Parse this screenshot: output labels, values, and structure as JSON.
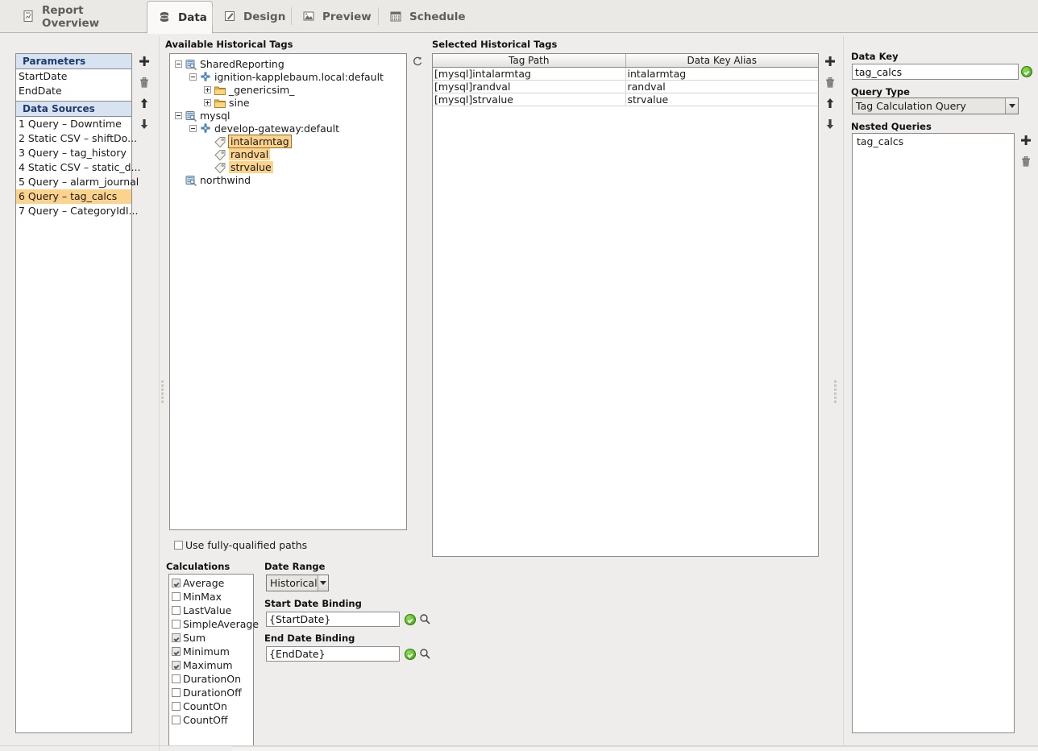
{
  "tabs": [
    {
      "label": "Report Overview",
      "icon": "report-icon",
      "active": false
    },
    {
      "label": "Data",
      "icon": "database-icon",
      "active": true
    },
    {
      "label": "Design",
      "icon": "pencil-icon",
      "active": false
    },
    {
      "label": "Preview",
      "icon": "image-icon",
      "active": false
    },
    {
      "label": "Schedule",
      "icon": "calendar-icon",
      "active": false
    }
  ],
  "left_panel": {
    "parameters_header": "Parameters",
    "parameters": [
      "StartDate",
      "EndDate"
    ],
    "data_sources_header": "Data Sources",
    "data_sources": [
      {
        "label": "1 Query – Downtime",
        "selected": false
      },
      {
        "label": "2 Static CSV – shiftDo...",
        "selected": false
      },
      {
        "label": "3 Query – tag_history",
        "selected": false
      },
      {
        "label": "4 Static CSV – static_d...",
        "selected": false
      },
      {
        "label": "5 Query – alarm_journal",
        "selected": false
      },
      {
        "label": "6 Query – tag_calcs",
        "selected": true
      },
      {
        "label": "7 Query – CategoryIdI...",
        "selected": false
      }
    ],
    "buttons": [
      {
        "name": "add-datasource-button",
        "icon": "plus-icon"
      },
      {
        "name": "delete-datasource-button",
        "icon": "trash-icon"
      },
      {
        "name": "move-up-datasource-button",
        "icon": "arrow-up-icon"
      },
      {
        "name": "move-down-datasource-button",
        "icon": "arrow-down-icon"
      }
    ]
  },
  "available_tags": {
    "title": "Available Historical Tags",
    "refresh_icon": "refresh-icon",
    "tree": [
      {
        "label": "SharedReporting",
        "depth": 0,
        "toggle": "minus",
        "icon": "db-icon",
        "highlight": "none"
      },
      {
        "label": "ignition-kapplebaum.local:default",
        "depth": 1,
        "toggle": "minus",
        "icon": "gateway-icon",
        "highlight": "none"
      },
      {
        "label": "_genericsim_",
        "depth": 2,
        "toggle": "plus",
        "icon": "folder-icon",
        "highlight": "none"
      },
      {
        "label": "sine",
        "depth": 2,
        "toggle": "plus",
        "icon": "folder-icon",
        "highlight": "none"
      },
      {
        "label": "mysql",
        "depth": 0,
        "toggle": "minus",
        "icon": "db-icon",
        "highlight": "none"
      },
      {
        "label": "develop-gateway:default",
        "depth": 1,
        "toggle": "minus",
        "icon": "gateway-icon",
        "highlight": "none"
      },
      {
        "label": "intalarmtag",
        "depth": 2,
        "toggle": "none",
        "icon": "tag-icon",
        "highlight": "boxed"
      },
      {
        "label": "randval",
        "depth": 2,
        "toggle": "none",
        "icon": "tag-icon",
        "highlight": "plain"
      },
      {
        "label": "strvalue",
        "depth": 2,
        "toggle": "none",
        "icon": "tag-icon",
        "highlight": "plain"
      },
      {
        "label": "northwind",
        "depth": 0,
        "toggle": "none",
        "icon": "db-icon",
        "highlight": "none"
      }
    ],
    "fully_qualified_checkbox": {
      "label": "Use fully-qualified paths",
      "checked": false
    }
  },
  "selected_tags": {
    "title": "Selected Historical Tags",
    "columns": [
      "Tag Path",
      "Data Key Alias"
    ],
    "rows": [
      [
        "[mysql]intalarmtag",
        "intalarmtag"
      ],
      [
        "[mysql]randval",
        "randval"
      ],
      [
        "[mysql]strvalue",
        "strvalue"
      ]
    ],
    "buttons": [
      {
        "name": "add-tag-button",
        "icon": "plus-icon"
      },
      {
        "name": "delete-tag-button",
        "icon": "trash-icon"
      },
      {
        "name": "move-up-tag-button",
        "icon": "arrow-up-icon"
      },
      {
        "name": "move-down-tag-button",
        "icon": "arrow-down-icon"
      }
    ]
  },
  "calculations": {
    "title": "Calculations",
    "items": [
      {
        "label": "Average",
        "checked": true
      },
      {
        "label": "MinMax",
        "checked": false
      },
      {
        "label": "LastValue",
        "checked": false
      },
      {
        "label": "SimpleAverage",
        "checked": false
      },
      {
        "label": "Sum",
        "checked": true
      },
      {
        "label": "Minimum",
        "checked": true
      },
      {
        "label": "Maximum",
        "checked": true
      },
      {
        "label": "DurationOn",
        "checked": false
      },
      {
        "label": "DurationOff",
        "checked": false
      },
      {
        "label": "CountOn",
        "checked": false
      },
      {
        "label": "CountOff",
        "checked": false
      }
    ]
  },
  "date_range": {
    "title": "Date Range",
    "mode_value": "Historical",
    "start_label": "Start Date Binding",
    "start_value": "{StartDate}",
    "end_label": "End Date Binding",
    "end_value": "{EndDate}"
  },
  "right_panel": {
    "data_key_label": "Data Key",
    "data_key_value": "tag_calcs",
    "query_type_label": "Query Type",
    "query_type_value": "Tag Calculation Query",
    "nested_queries_label": "Nested Queries",
    "nested_queries": [
      "tag_calcs"
    ],
    "buttons": [
      {
        "name": "add-nested-query-button",
        "icon": "plus-icon"
      },
      {
        "name": "delete-nested-query-button",
        "icon": "trash-icon"
      }
    ]
  },
  "colors": {
    "selection_orange": "#fbd38d",
    "header_blue": "#d7e3f1",
    "header_text": "#1f3a6e",
    "window_bg": "#eeedeb",
    "ok_green": "#3d9e10"
  }
}
